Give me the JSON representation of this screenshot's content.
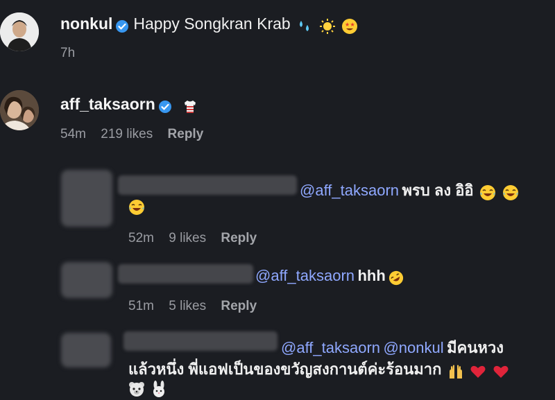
{
  "comments": [
    {
      "username": "nonkul",
      "text": "Happy Songkran Krab",
      "emojis": [
        "sweat-droplets-icon",
        "sun-icon",
        "star-struck-icon"
      ],
      "time": "7h"
    },
    {
      "username": "aff_taksaorn",
      "emojis": [
        "shirt-icon"
      ],
      "time": "54m",
      "likes": "219 likes",
      "reply": "Reply"
    }
  ],
  "replies": [
    {
      "mention": "@aff_taksaorn",
      "text": "พรบ ลง อิอิ",
      "emojis": [
        "laughing-tears-icon",
        "laughing-tears-icon",
        "laughing-tears-icon"
      ],
      "time": "52m",
      "likes": "9 likes",
      "reply": "Reply"
    },
    {
      "mention": "@aff_taksaorn",
      "text": "hhh",
      "emojis": [
        "rofl-icon"
      ],
      "time": "51m",
      "likes": "5 likes",
      "reply": "Reply"
    },
    {
      "mention": "@aff_taksaorn",
      "mention2": "@nonkul",
      "text_line1": "มีคนหวง",
      "text_line2": "แล้วหนึ่ง พี่แอฟเป็นของขวัญสงกานต์ค่ะร้อนมาก",
      "emojis": [
        "raised-hands-icon",
        "red-heart-icon",
        "red-heart-icon",
        "bear-icon",
        "rabbit-icon"
      ]
    }
  ],
  "colors": {
    "background": "#1b1d22",
    "mention": "#8fa8ff",
    "verified": "#3897f0",
    "meta": "#9a9ca2"
  }
}
